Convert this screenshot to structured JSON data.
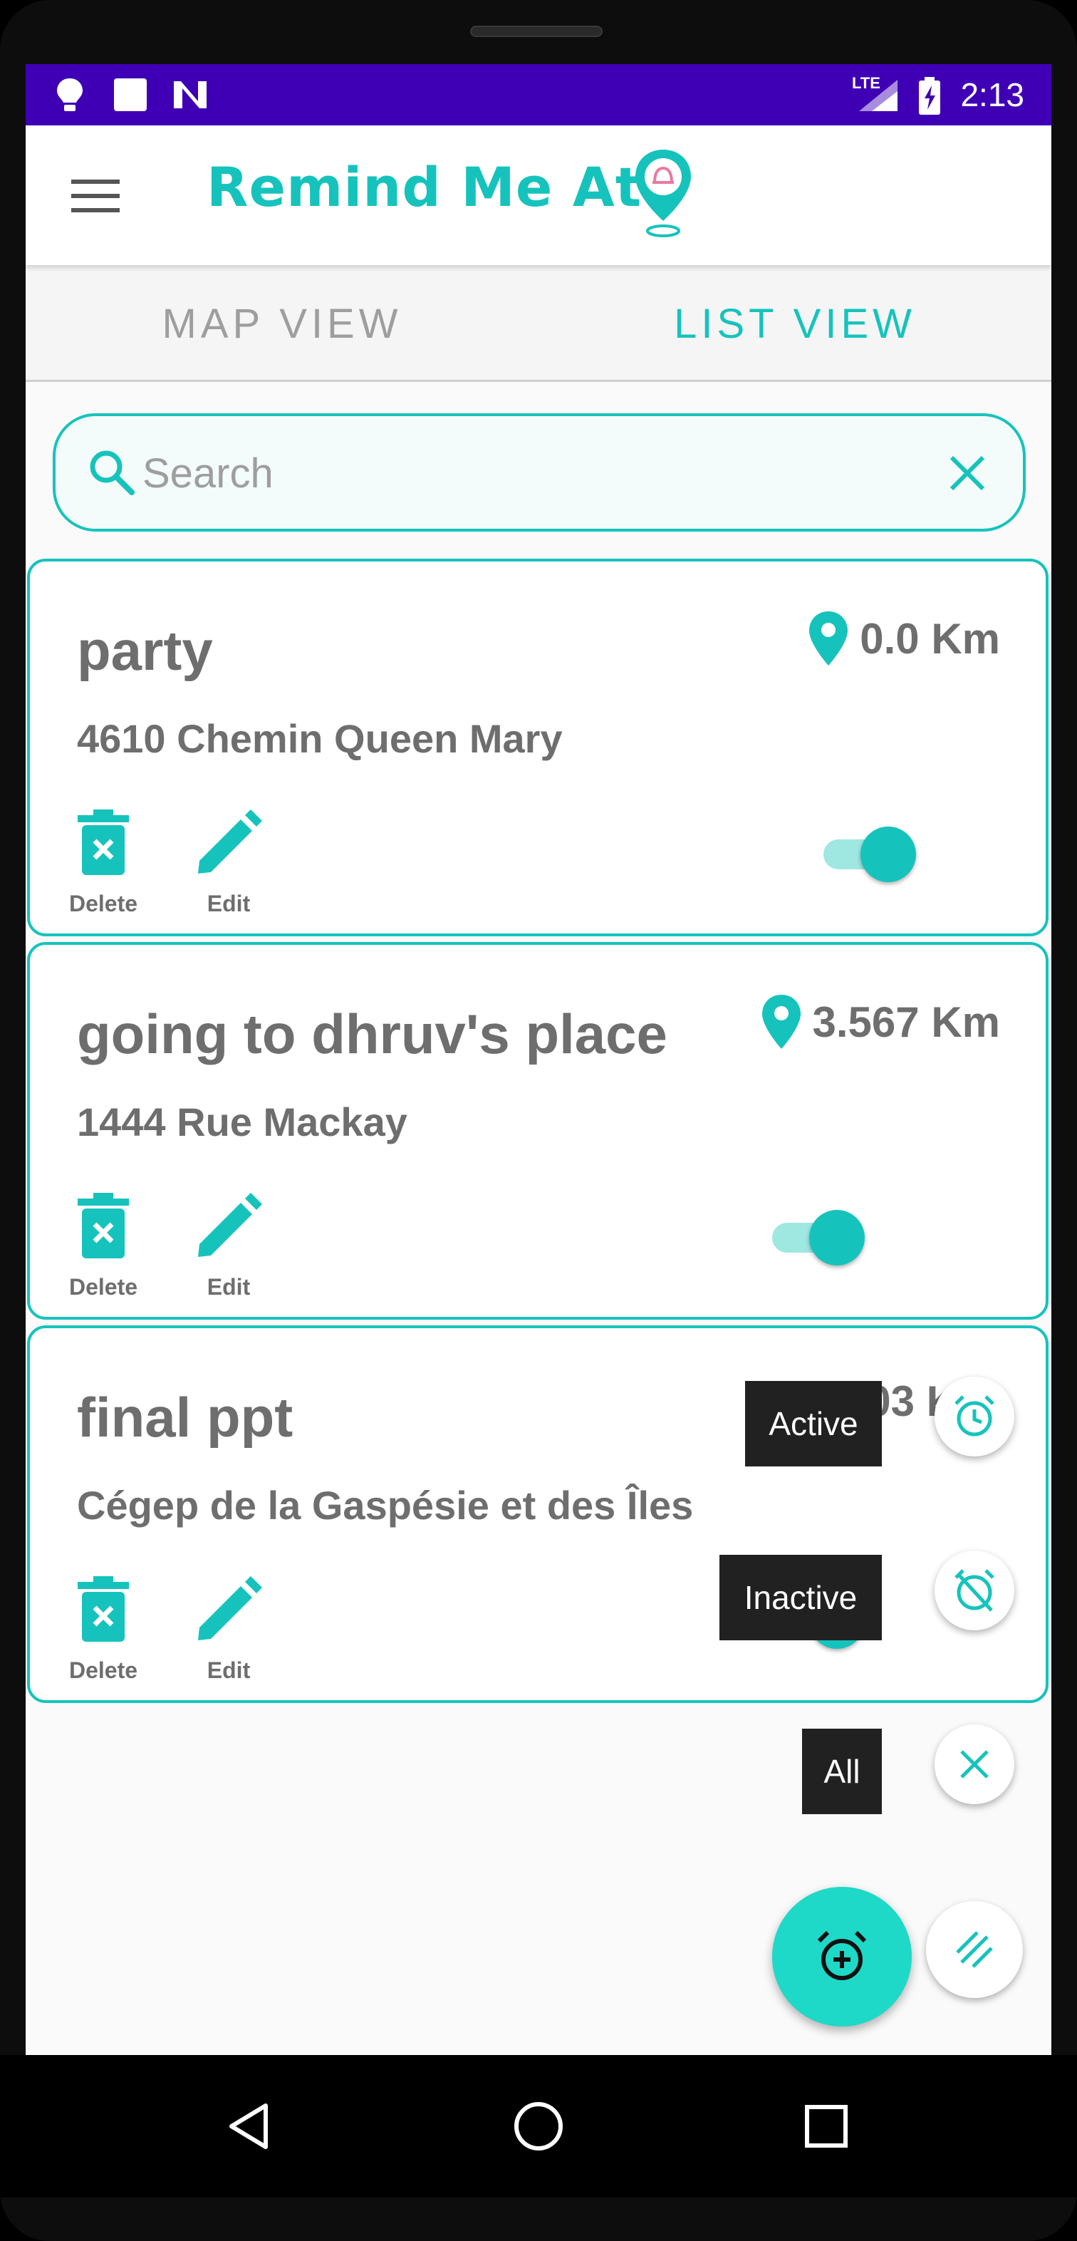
{
  "status_bar": {
    "time": "2:13",
    "network": "LTE",
    "icons": [
      "bulb-icon",
      "square-icon",
      "n-icon",
      "signal-icon",
      "battery-charging-icon"
    ]
  },
  "app_bar": {
    "title": "Remind Me At",
    "menu_icon": "hamburger-menu-icon",
    "logo_icon": "location-pin-logo-icon"
  },
  "tabs": [
    {
      "label": "MAP VIEW",
      "selected": false
    },
    {
      "label": "LIST VIEW",
      "selected": true
    }
  ],
  "search": {
    "placeholder": "Search",
    "value": ""
  },
  "reminders": [
    {
      "title": "party",
      "address": "4610 Chemin Queen Mary",
      "distance": "0.0 Km",
      "active": true,
      "delete_label": "Delete",
      "edit_label": "Edit"
    },
    {
      "title": "going to dhruv's place",
      "address": "1444 Rue Mackay",
      "distance": "3.567 Km",
      "active": true,
      "delete_label": "Delete",
      "edit_label": "Edit"
    },
    {
      "title": "final ppt",
      "address": "Cégep de la Gaspésie et des Îles",
      "distance": "03 K",
      "active": true,
      "delete_label": "Delete",
      "edit_label": "Edit"
    }
  ],
  "filter_menu": {
    "active_label": "Active",
    "inactive_label": "Inactive",
    "all_label": "All"
  },
  "colors": {
    "accent": "#16c3bc",
    "status_bar": "#3f00b5",
    "fab": "#1ed9c7",
    "text_gray": "#6e6e6e"
  }
}
